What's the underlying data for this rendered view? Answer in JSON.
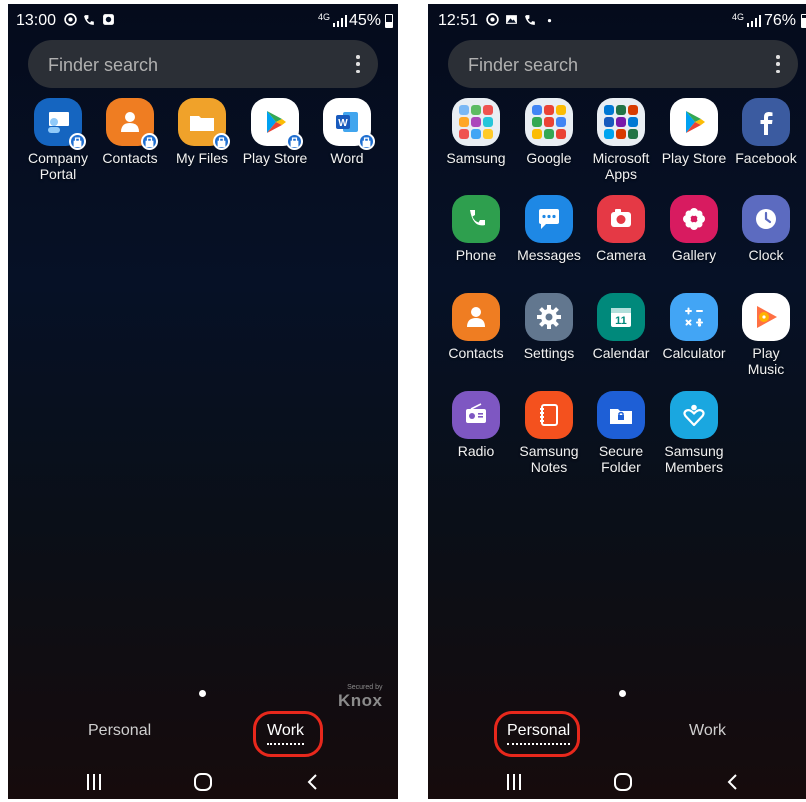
{
  "left": {
    "status": {
      "time": "13:00",
      "net": "4G",
      "battery": "45%",
      "battery_level": 0.45,
      "icons": [
        "target-icon",
        "wifi-calling-icon",
        "instagram-icon"
      ]
    },
    "search": {
      "placeholder": "Finder search"
    },
    "apps": [
      {
        "name": "company-portal",
        "label": "Company\nPortal",
        "color": "#1565c0",
        "icon": "company-portal-icon"
      },
      {
        "name": "contacts",
        "label": "Contacts",
        "color": "#ef7d22",
        "icon": "person-icon"
      },
      {
        "name": "my-files",
        "label": "My Files",
        "color": "#f0a22a",
        "icon": "folder-icon"
      },
      {
        "name": "play-store",
        "label": "Play Store",
        "color": "#ffffff",
        "icon": "play-store-icon"
      },
      {
        "name": "word",
        "label": "Word",
        "color": "#ffffff",
        "icon": "word-icon"
      }
    ],
    "knox": {
      "small": "Secured by",
      "big": "Knox"
    },
    "tabs": {
      "personal": "Personal",
      "work": "Work",
      "active": "work"
    }
  },
  "right": {
    "status": {
      "time": "12:51",
      "net": "4G",
      "battery": "76%",
      "battery_level": 0.76,
      "icons": [
        "target-icon",
        "image-icon",
        "wifi-calling-icon",
        "dot-icon"
      ]
    },
    "search": {
      "placeholder": "Finder search"
    },
    "apps": [
      {
        "name": "samsung-folder",
        "label": "Samsung",
        "icon": "folder-icon"
      },
      {
        "name": "google-folder",
        "label": "Google",
        "icon": "folder-icon"
      },
      {
        "name": "microsoft-apps-folder",
        "label": "Microsoft\nApps",
        "icon": "folder-icon"
      },
      {
        "name": "play-store",
        "label": "Play Store",
        "icon": "play-store-icon"
      },
      {
        "name": "facebook",
        "label": "Facebook",
        "icon": "facebook-icon"
      },
      {
        "name": "phone",
        "label": "Phone",
        "icon": "phone-icon"
      },
      {
        "name": "messages",
        "label": "Messages",
        "icon": "chat-icon"
      },
      {
        "name": "camera",
        "label": "Camera",
        "icon": "camera-icon"
      },
      {
        "name": "gallery",
        "label": "Gallery",
        "icon": "flower-icon"
      },
      {
        "name": "clock",
        "label": "Clock",
        "icon": "clock-icon"
      },
      {
        "name": "contacts",
        "label": "Contacts",
        "icon": "person-icon"
      },
      {
        "name": "settings",
        "label": "Settings",
        "icon": "gear-icon"
      },
      {
        "name": "calendar",
        "label": "Calendar",
        "icon": "calendar-icon"
      },
      {
        "name": "calculator",
        "label": "Calculator",
        "icon": "calculator-icon"
      },
      {
        "name": "play-music",
        "label": "Play\nMusic",
        "icon": "play-music-icon"
      },
      {
        "name": "radio",
        "label": "Radio",
        "icon": "radio-icon"
      },
      {
        "name": "samsung-notes",
        "label": "Samsung\nNotes",
        "icon": "notes-icon"
      },
      {
        "name": "secure-folder",
        "label": "Secure\nFolder",
        "icon": "secure-folder-icon"
      },
      {
        "name": "samsung-members",
        "label": "Samsung\nMembers",
        "icon": "heart-icon"
      }
    ],
    "tabs": {
      "personal": "Personal",
      "work": "Work",
      "active": "personal"
    }
  },
  "colors": {
    "annotation": "#e8281c",
    "badge": "#1f6fd1",
    "search_bg": "#2b2f36"
  }
}
